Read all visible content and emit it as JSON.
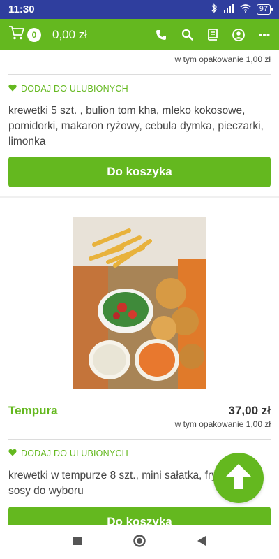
{
  "status_bar": {
    "time": "11:30",
    "battery": "97",
    "icons": [
      "bluetooth-icon",
      "signal-icon",
      "wifi-icon",
      "battery-icon"
    ]
  },
  "app_bar": {
    "cart_count": "0",
    "cart_total": "0,00 zł",
    "icons": [
      "phone-icon",
      "search-icon",
      "menu-book-icon",
      "account-icon",
      "more-icon"
    ]
  },
  "products": [
    {
      "packaging_note": "w tym opakowanie 1,00 zł",
      "favorite_label": "DODAJ DO ULUBIONYCH",
      "description": "krewetki 5 szt. , bulion tom kha, mleko kokosowe, pomidorki, makaron ryżowy, cebula dymka, pieczarki, limonka",
      "button_label": "Do koszyka"
    },
    {
      "name": "Tempura",
      "price": "37,00 zł",
      "packaging_note": "w tym opakowanie 1,00 zł",
      "favorite_label": "DODAJ DO ULUBIONYCH",
      "description": "krewetki w tempurze 8 szt., mini sałatka, frytki, dwa sosy do wyboru",
      "button_label": "Do koszyka"
    }
  ],
  "colors": {
    "accent": "#64b81f",
    "status_bar": "#2f3e9e"
  }
}
